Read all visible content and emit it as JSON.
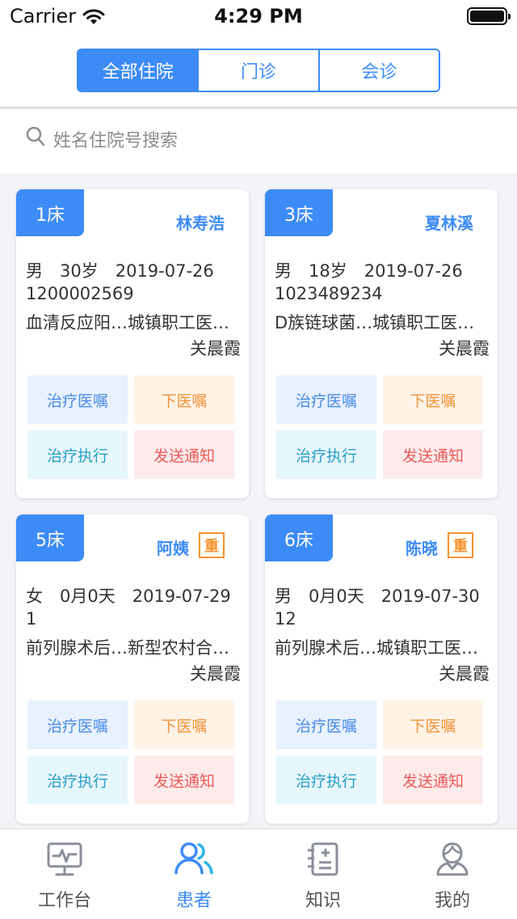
{
  "status_bar": {
    "carrier": "Carrier",
    "time": "4:29 PM"
  },
  "segments": [
    {
      "label": "全部住院",
      "active": true
    },
    {
      "label": "门诊",
      "active": false
    },
    {
      "label": "会诊",
      "active": false
    }
  ],
  "search": {
    "placeholder": "姓名住院号搜索"
  },
  "patients": [
    {
      "bed": "1床",
      "name": "林寿浩",
      "badge": "",
      "line1": "男　30岁　2019-07-26",
      "line2": "1200002569",
      "line3": "血清反应阳…城镇职工医…",
      "doctor": "关晨霞",
      "actions": [
        "治疗医嘱",
        "下医嘱",
        "治疗执行",
        "发送通知"
      ]
    },
    {
      "bed": "3床",
      "name": "夏林溪",
      "badge": "",
      "line1": "男　18岁　2019-07-26",
      "line2": "1023489234",
      "line3": "D族链球菌…城镇职工医…",
      "doctor": "关晨霞",
      "actions": [
        "治疗医嘱",
        "下医嘱",
        "治疗执行",
        "发送通知"
      ]
    },
    {
      "bed": "5床",
      "name": "阿姨",
      "badge": "重",
      "line1": "女　0月0天　2019-07-29",
      "line2": "1",
      "line3": "前列腺术后…新型农村合…",
      "doctor": "关晨霞",
      "actions": [
        "治疗医嘱",
        "下医嘱",
        "治疗执行",
        "发送通知"
      ]
    },
    {
      "bed": "6床",
      "name": "陈晓",
      "badge": "重",
      "line1": "男　0月0天　2019-07-30",
      "line2": "12",
      "line3": "前列腺术后…城镇职工医…",
      "doctor": "关晨霞",
      "actions": [
        "治疗医嘱",
        "下医嘱",
        "治疗执行",
        "发送通知"
      ]
    }
  ],
  "tabbar": [
    {
      "label": "工作台",
      "icon": "monitor-icon",
      "active": false
    },
    {
      "label": "患者",
      "icon": "patients-icon",
      "active": true
    },
    {
      "label": "知识",
      "icon": "knowledge-icon",
      "active": false
    },
    {
      "label": "我的",
      "icon": "profile-icon",
      "active": false
    }
  ],
  "colors": {
    "primary": "#3d8bf7",
    "badge": "#f5922f"
  }
}
